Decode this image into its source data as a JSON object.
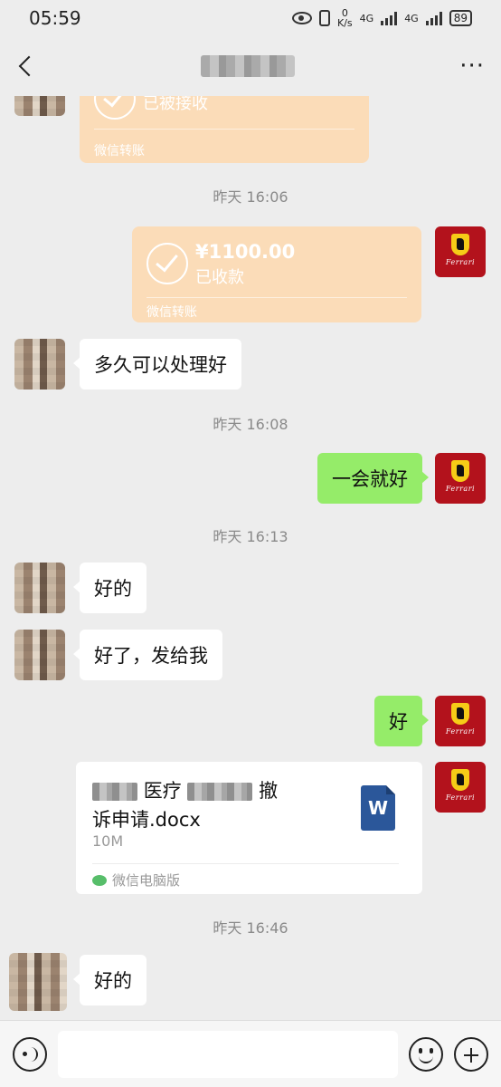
{
  "status_bar": {
    "time": "05:59",
    "net_speed_value": "0",
    "net_speed_unit": "K/s",
    "signal_1_label": "4G",
    "signal_2_label": "4G",
    "battery": "89"
  },
  "header": {
    "title": ""
  },
  "messages": {
    "transfer_1": {
      "status": "已被接收",
      "footer": "微信转账"
    },
    "time_1": "昨天 16:06",
    "transfer_2": {
      "amount": "¥1100.00",
      "status": "已收款",
      "footer": "微信转账"
    },
    "msg_1": "多久可以处理好",
    "time_2": "昨天 16:08",
    "msg_2": "一会就好",
    "time_3": "昨天 16:13",
    "msg_3": "好的",
    "msg_4": "好了，发给我",
    "msg_5": "好",
    "file": {
      "name_part_1": "医疗",
      "name_part_2": "撤",
      "name_part_3": "诉申请.docx",
      "size": "10M",
      "source": "微信电脑版",
      "icon_letter": "W"
    },
    "time_4": "昨天 16:46",
    "msg_6": "好的"
  },
  "self_avatar": {
    "brand_text": "Ferrari"
  },
  "input_bar": {
    "placeholder": ""
  },
  "colors": {
    "background": "#ededed",
    "self_bubble": "#95ec69",
    "other_bubble": "#ffffff",
    "transfer_card": "#fbdcb8",
    "avatar_red": "#b3121c"
  }
}
